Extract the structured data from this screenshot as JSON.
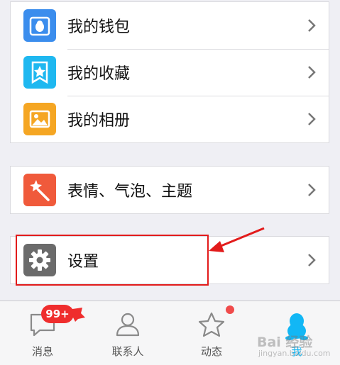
{
  "menu": {
    "group1": [
      {
        "label": "我的钱包",
        "icon": "wallet-penguin-icon",
        "color": "#3b8ded"
      },
      {
        "label": "我的收藏",
        "icon": "star-bookmark-icon",
        "color": "#1fb8f0"
      },
      {
        "label": "我的相册",
        "icon": "photo-album-icon",
        "color": "#f5a623"
      }
    ],
    "group2": [
      {
        "label": "表情、气泡、主题",
        "icon": "magic-wand-icon",
        "color": "#f05a3b"
      }
    ],
    "group3": [
      {
        "label": "设置",
        "icon": "gear-icon",
        "color": "#6b6b6b"
      }
    ]
  },
  "tabbar": {
    "tabs": [
      {
        "label": "消息",
        "icon": "chat-bubble-icon"
      },
      {
        "label": "联系人",
        "icon": "contacts-person-icon"
      },
      {
        "label": "动态",
        "icon": "star-outline-icon"
      },
      {
        "label": "我",
        "icon": "qq-penguin-icon",
        "active": true
      }
    ],
    "message_badge": "99+",
    "active_color": "#12b7f5"
  },
  "watermark": {
    "text": "Bai 经验",
    "sub": "jingyan.baidu.com"
  },
  "annotation": {
    "highlight_color": "#e21b1b"
  }
}
